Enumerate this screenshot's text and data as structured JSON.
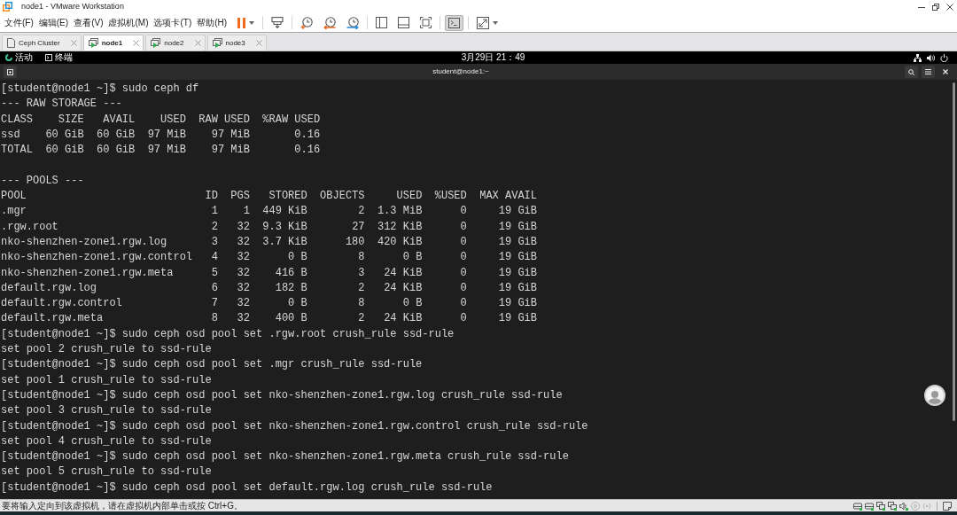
{
  "window": {
    "title": "node1 - VMware Workstation"
  },
  "menu": [
    "文件(F)",
    "编辑(E)",
    "查看(V)",
    "虚拟机(M)",
    "选项卡(T)",
    "帮助(H)"
  ],
  "toolbar_groups": [
    {
      "items": [
        {
          "kind": "pause",
          "selected": false
        }
      ]
    },
    {
      "items": [
        {
          "kind": "keys",
          "selected": false
        }
      ]
    },
    {
      "items": [
        {
          "kind": "snapshot",
          "selected": false
        },
        {
          "kind": "revert",
          "selected": false
        },
        {
          "kind": "manager",
          "selected": false
        }
      ]
    },
    {
      "items": [
        {
          "kind": "library",
          "selected": false
        },
        {
          "kind": "thumbnails",
          "selected": false
        },
        {
          "kind": "fit",
          "selected": false
        }
      ]
    },
    {
      "items": [
        {
          "kind": "console",
          "selected": true
        }
      ]
    },
    {
      "items": [
        {
          "kind": "fullscreen",
          "selected": false
        }
      ]
    }
  ],
  "tabs": [
    {
      "label": "Ceph Cluster",
      "kind": "team",
      "selected": false
    },
    {
      "label": "node1",
      "kind": "vm",
      "selected": true
    },
    {
      "label": "node2",
      "kind": "vm",
      "selected": false
    },
    {
      "label": "node3",
      "kind": "vm",
      "selected": false
    }
  ],
  "top_bar": {
    "activities": "活动",
    "app": "终端",
    "clock": "3月29日 21：49"
  },
  "terminal": {
    "title": "student@node1:~",
    "lines": [
      {
        "kind": "command",
        "prompt": "[student@node1 ~]$",
        "command": "sudo ceph df"
      },
      {
        "kind": "output",
        "text": "--- RAW STORAGE ---"
      },
      {
        "kind": "table",
        "columns": [
          "CLASS",
          "SIZE",
          "AVAIL",
          "USED",
          "RAW USED",
          "%RAW USED"
        ],
        "rows": [
          [
            "ssd",
            "60 GiB",
            "60 GiB",
            "97 MiB",
            "97 MiB",
            "0.16"
          ],
          [
            "TOTAL",
            "60 GiB",
            "60 GiB",
            "97 MiB",
            "97 MiB",
            "0.16"
          ]
        ]
      },
      {
        "kind": "blank"
      },
      {
        "kind": "output",
        "text": "--- POOLS ---"
      },
      {
        "kind": "table",
        "columns": [
          "POOL",
          "ID",
          "PGS",
          "STORED",
          "OBJECTS",
          "USED",
          "%USED",
          "MAX AVAIL"
        ],
        "rows": [
          [
            ".mgr",
            "1",
            "1",
            "449 KiB",
            "2",
            "1.3 MiB",
            "0",
            "19 GiB"
          ],
          [
            ".rgw.root",
            "2",
            "32",
            "9.3 KiB",
            "27",
            "312 KiB",
            "0",
            "19 GiB"
          ],
          [
            "nko-shenzhen-zone1.rgw.log",
            "3",
            "32",
            "3.7 KiB",
            "180",
            "420 KiB",
            "0",
            "19 GiB"
          ],
          [
            "nko-shenzhen-zone1.rgw.control",
            "4",
            "32",
            "0 B",
            "8",
            "0 B",
            "0",
            "19 GiB"
          ],
          [
            "nko-shenzhen-zone1.rgw.meta",
            "5",
            "32",
            "416 B",
            "3",
            "24 KiB",
            "0",
            "19 GiB"
          ],
          [
            "default.rgw.log",
            "6",
            "32",
            "182 B",
            "2",
            "24 KiB",
            "0",
            "19 GiB"
          ],
          [
            "default.rgw.control",
            "7",
            "32",
            "0 B",
            "8",
            "0 B",
            "0",
            "19 GiB"
          ],
          [
            "default.rgw.meta",
            "8",
            "32",
            "400 B",
            "2",
            "24 KiB",
            "0",
            "19 GiB"
          ]
        ]
      },
      {
        "kind": "command",
        "prompt": "[student@node1 ~]$",
        "command": "sudo ceph osd pool set .rgw.root crush_rule ssd-rule"
      },
      {
        "kind": "output",
        "text": "set pool 2 crush_rule to ssd-rule"
      },
      {
        "kind": "command",
        "prompt": "[student@node1 ~]$",
        "command": "sudo ceph osd pool set .mgr crush_rule ssd-rule"
      },
      {
        "kind": "output",
        "text": "set pool 1 crush_rule to ssd-rule"
      },
      {
        "kind": "command",
        "prompt": "[student@node1 ~]$",
        "command": "sudo ceph osd pool set nko-shenzhen-zone1.rgw.log crush_rule ssd-rule"
      },
      {
        "kind": "output",
        "text": "set pool 3 crush_rule to ssd-rule"
      },
      {
        "kind": "command",
        "prompt": "[student@node1 ~]$",
        "command": "sudo ceph osd pool set nko-shenzhen-zone1.rgw.control crush_rule ssd-rule"
      },
      {
        "kind": "output",
        "text": "set pool 4 crush_rule to ssd-rule"
      },
      {
        "kind": "command",
        "prompt": "[student@node1 ~]$",
        "command": "sudo ceph osd pool set nko-shenzhen-zone1.rgw.meta crush_rule ssd-rule"
      },
      {
        "kind": "output",
        "text": "set pool 5 crush_rule to ssd-rule"
      },
      {
        "kind": "command",
        "prompt": "[student@node1 ~]$",
        "command": "sudo ceph osd pool set default.rgw.log crush_rule ssd-rule"
      }
    ]
  },
  "status_bar": {
    "message": "要将输入定向到该虚拟机，请在虚拟机内部单击或按 Ctrl+G。",
    "devices": [
      {
        "kind": "disk",
        "connected": true
      },
      {
        "kind": "disk",
        "connected": true
      },
      {
        "kind": "network",
        "connected": true
      },
      {
        "kind": "network",
        "connected": true
      },
      {
        "kind": "sound",
        "connected": true
      },
      {
        "kind": "disc",
        "connected": false
      },
      {
        "kind": "signal",
        "connected": false
      }
    ]
  }
}
